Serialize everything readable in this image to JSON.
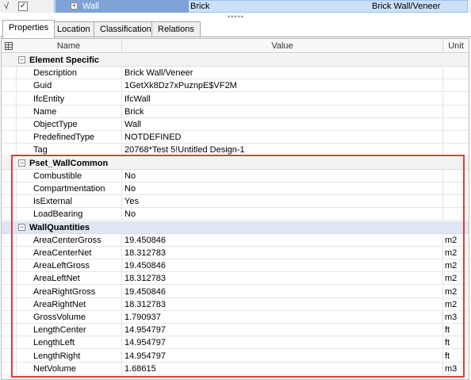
{
  "top_row": {
    "checkmark": "√",
    "checkbox": "✓",
    "expander": "+",
    "name": "Wall",
    "material": "Brick",
    "type": "Brick Wall/Veneer"
  },
  "splitter": "•••••",
  "tabs": [
    "Properties",
    "Location",
    "Classification",
    "Relations"
  ],
  "active_tab": "Properties",
  "columns": {
    "name": "Name",
    "value": "Value",
    "unit": "Unit"
  },
  "groups": [
    {
      "label": "Element Specific",
      "rows": [
        {
          "name": "Description",
          "value": "Brick Wall/Veneer",
          "unit": ""
        },
        {
          "name": "Guid",
          "value": "1GetXk8Dz7xPuznpE$VF2M",
          "unit": ""
        },
        {
          "name": "IfcEntity",
          "value": "IfcWall",
          "unit": ""
        },
        {
          "name": "Name",
          "value": "Brick",
          "unit": ""
        },
        {
          "name": "ObjectType",
          "value": "Wall",
          "unit": ""
        },
        {
          "name": "PredefinedType",
          "value": "NOTDEFINED",
          "unit": ""
        },
        {
          "name": "Tag",
          "value": "20768*Test 5!Untitled Design-1",
          "unit": ""
        }
      ]
    },
    {
      "label": "Pset_WallCommon",
      "rows": [
        {
          "name": "Combustible",
          "value": "No",
          "unit": ""
        },
        {
          "name": "Compartmentation",
          "value": "No",
          "unit": ""
        },
        {
          "name": "IsExternal",
          "value": "Yes",
          "unit": ""
        },
        {
          "name": "LoadBearing",
          "value": "No",
          "unit": ""
        }
      ]
    },
    {
      "label": "WallQuantities",
      "rows": [
        {
          "name": "AreaCenterGross",
          "value": "19.450846",
          "unit": "m2"
        },
        {
          "name": "AreaCenterNet",
          "value": "18.312783",
          "unit": "m2"
        },
        {
          "name": "AreaLeftGross",
          "value": "19.450846",
          "unit": "m2"
        },
        {
          "name": "AreaLeftNet",
          "value": "18.312783",
          "unit": "m2"
        },
        {
          "name": "AreaRightGross",
          "value": "19.450846",
          "unit": "m2"
        },
        {
          "name": "AreaRightNet",
          "value": "18.312783",
          "unit": "m2"
        },
        {
          "name": "GrossVolume",
          "value": "1.790937",
          "unit": "m3"
        },
        {
          "name": "LengthCenter",
          "value": "14.954797",
          "unit": "ft"
        },
        {
          "name": "LengthLeft",
          "value": "14.954797",
          "unit": "ft"
        },
        {
          "name": "LengthRight",
          "value": "14.954797",
          "unit": "ft"
        },
        {
          "name": "NetVolume",
          "value": "1.68615",
          "unit": "m3"
        }
      ]
    }
  ],
  "colors": {
    "selection": "#7fa3d6",
    "highlight_box": "#e23a3a",
    "group_blue": "#dde6f2"
  }
}
